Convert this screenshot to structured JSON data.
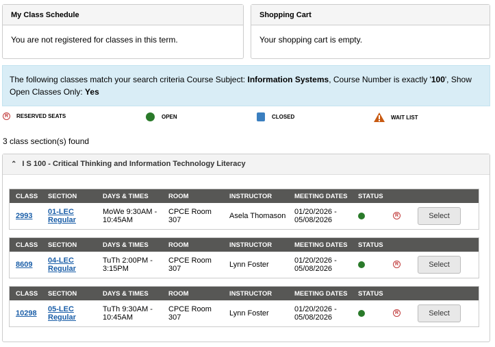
{
  "schedule": {
    "title": "My Class Schedule",
    "message": "You are not registered for classes in this term."
  },
  "cart": {
    "title": "Shopping Cart",
    "message": "Your shopping cart is empty."
  },
  "criteria": {
    "prefix": "The following classes match your search criteria Course Subject: ",
    "subject": "Information Systems",
    "mid1": ",  Course Number is exactly '",
    "number": "100",
    "mid2": "',  Show Open Classes Only: ",
    "open_only": "Yes"
  },
  "legend": {
    "reserved": "RESERVED SEATS",
    "open": "OPEN",
    "closed": "CLOSED",
    "waitlist": "WAIT LIST"
  },
  "colors": {
    "open": "#2a7a2a",
    "closed": "#3b7fc0",
    "waitlist": "#c85a12",
    "reserved": "#c03838"
  },
  "found": "3 class section(s) found",
  "course": {
    "title": "I S 100 - Critical Thinking and Information Technology Literacy"
  },
  "headers": {
    "class": "CLASS",
    "section": "SECTION",
    "days": "DAYS & TIMES",
    "room": "ROOM",
    "instructor": "INSTRUCTOR",
    "dates": "MEETING DATES",
    "status": "STATUS"
  },
  "sections": [
    {
      "class": "2993",
      "section1": "01-LEC",
      "section2": "Regular",
      "days1": "MoWe 9:30AM -",
      "days2": "10:45AM",
      "room1": "CPCE  Room",
      "room2": "307",
      "instructor": "Asela Thomason",
      "dates1": "01/20/2026 -",
      "dates2": "05/08/2026",
      "status": "open",
      "button": "Select"
    },
    {
      "class": "8609",
      "section1": "04-LEC",
      "section2": "Regular",
      "days1": "TuTh 2:00PM -",
      "days2": "3:15PM",
      "room1": "CPCE  Room",
      "room2": "307",
      "instructor": "Lynn Foster",
      "dates1": "01/20/2026 -",
      "dates2": "05/08/2026",
      "status": "open",
      "button": "Select"
    },
    {
      "class": "10298",
      "section1": "05-LEC",
      "section2": "Regular",
      "days1": "TuTh 9:30AM -",
      "days2": "10:45AM",
      "room1": "CPCE  Room",
      "room2": "307",
      "instructor": "Lynn Foster",
      "dates1": "01/20/2026 -",
      "dates2": "05/08/2026",
      "status": "open",
      "button": "Select"
    }
  ]
}
